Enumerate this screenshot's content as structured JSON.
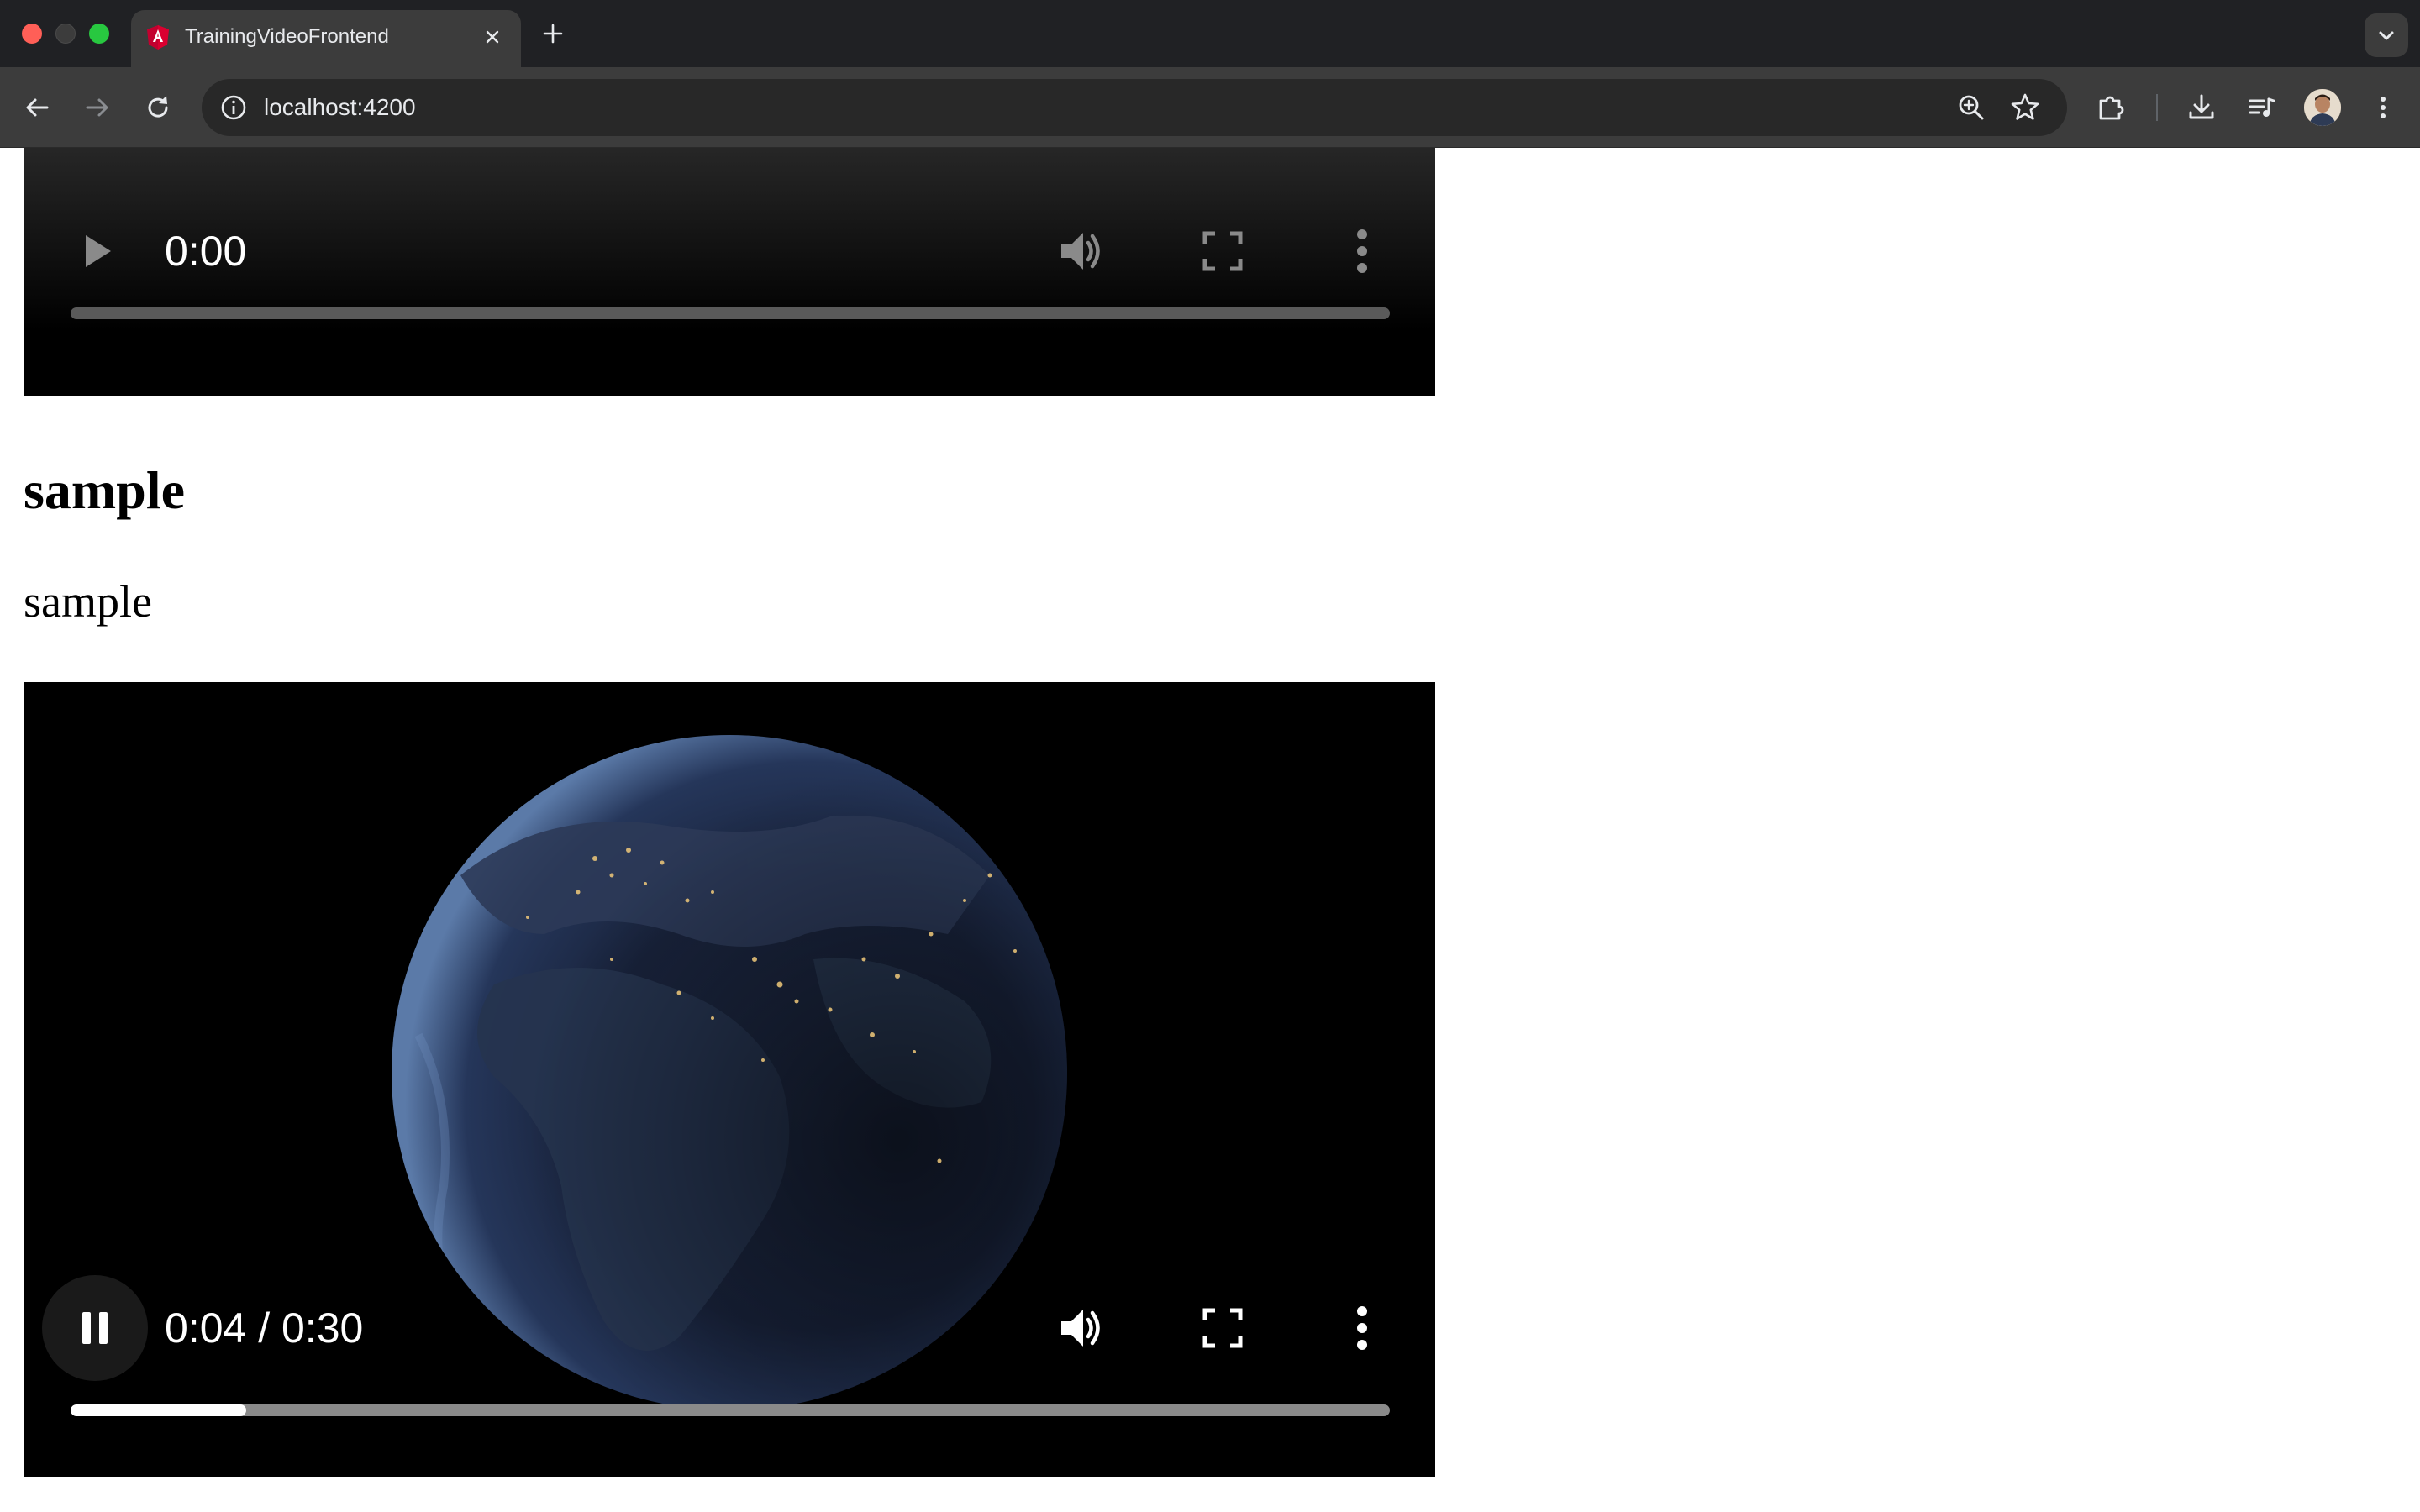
{
  "browser": {
    "tab_title": "TrainingVideoFrontend",
    "url": "localhost:4200"
  },
  "videos": [
    {
      "time_display": "0:00",
      "state": "paused",
      "progress": 0
    },
    {
      "time_display": "0:04 / 0:30",
      "state": "playing",
      "progress": 0.1333
    }
  ],
  "content": {
    "heading": "sample",
    "paragraph": "sample"
  },
  "colors": {
    "chrome_dark": "#202124",
    "toolbar": "#3c3c3c",
    "video_bg": "#000000",
    "progress_fill": "#ffffff",
    "progress_track": "#8a8a8a"
  },
  "icons": [
    "app-favicon",
    "close-icon",
    "plus-icon",
    "chevron-down-icon",
    "back-arrow-icon",
    "forward-arrow-icon",
    "reload-icon",
    "info-icon",
    "zoom-icon",
    "star-icon",
    "extensions-icon",
    "download-icon",
    "media-control-icon",
    "kebab-menu-icon",
    "play-icon",
    "pause-icon",
    "volume-icon",
    "fullscreen-icon"
  ]
}
